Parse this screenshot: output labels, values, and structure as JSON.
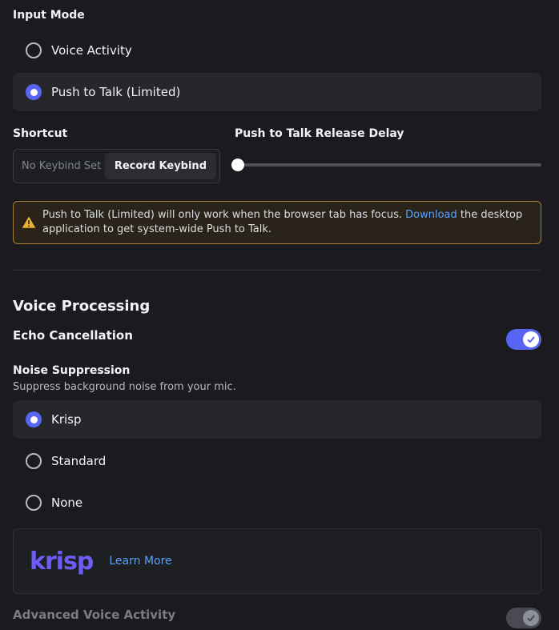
{
  "input_mode": {
    "title": "Input Mode",
    "options": [
      {
        "label": "Voice Activity",
        "selected": false
      },
      {
        "label": "Push to Talk (Limited)",
        "selected": true
      }
    ]
  },
  "shortcut": {
    "title": "Shortcut",
    "value": "No Keybind Set",
    "record_label": "Record Keybind"
  },
  "release_delay": {
    "title": "Push to Talk Release Delay",
    "value_fraction": 0
  },
  "warning": {
    "text_before": "Push to Talk (Limited) will only work when the browser tab has focus.",
    "link": "Download",
    "text_after": "the desktop application to get system-wide Push to Talk."
  },
  "voice_processing": {
    "title": "Voice Processing",
    "echo_cancellation": {
      "label": "Echo Cancellation",
      "enabled": true
    },
    "noise_suppression": {
      "title": "Noise Suppression",
      "description": "Suppress background noise from your mic.",
      "options": [
        {
          "label": "Krisp",
          "selected": true
        },
        {
          "label": "Standard",
          "selected": false
        },
        {
          "label": "None",
          "selected": false
        }
      ]
    },
    "krisp": {
      "logo": "krisp",
      "learn_more": "Learn More"
    },
    "advanced_voice_activity": {
      "label": "Advanced Voice Activity",
      "enabled": true
    }
  },
  "colors": {
    "accent": "#5865f2",
    "background": "#1b1b1f",
    "warning_border": "#a97c38",
    "link": "#5aa1f5",
    "krisp_brand": "#6e5cf6"
  }
}
